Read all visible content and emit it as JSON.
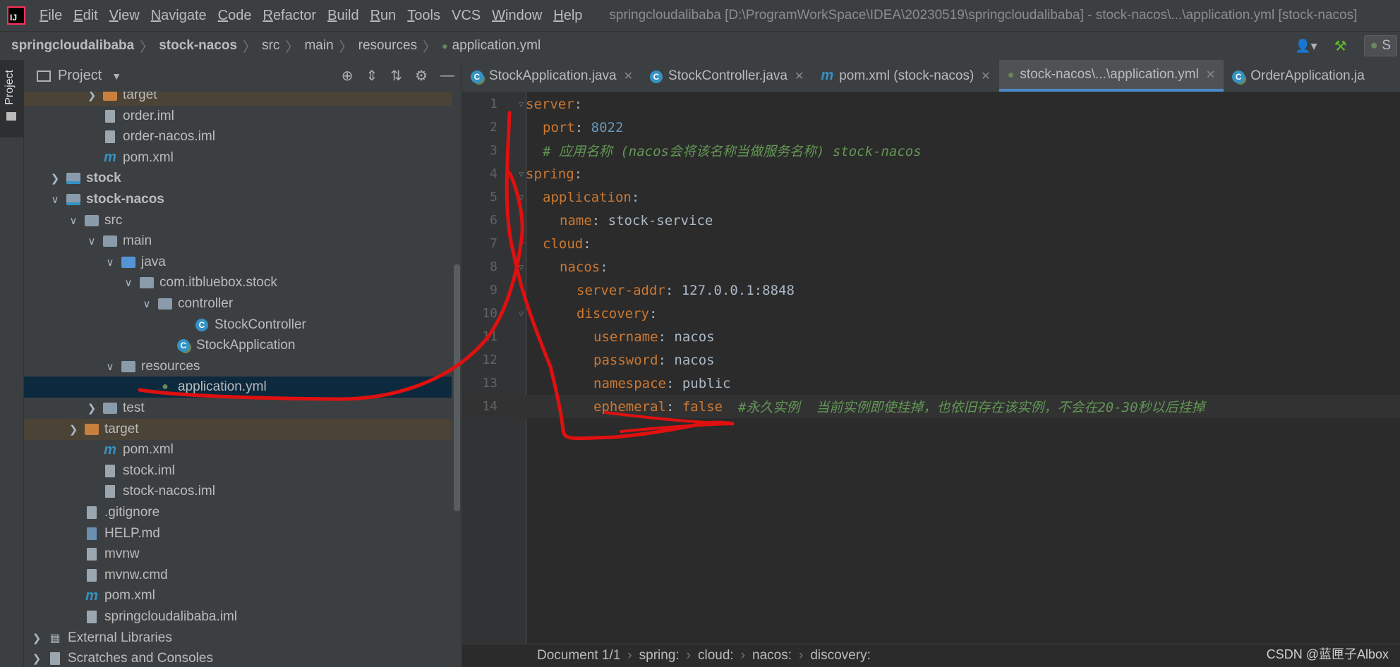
{
  "menubar": {
    "items": [
      {
        "u": "F",
        "rest": "ile"
      },
      {
        "u": "E",
        "rest": "dit"
      },
      {
        "u": "V",
        "rest": "iew"
      },
      {
        "u": "N",
        "rest": "avigate"
      },
      {
        "u": "C",
        "rest": "ode"
      },
      {
        "u": "R",
        "rest": "efactor"
      },
      {
        "u": "B",
        "rest": "uild"
      },
      {
        "u": "R",
        "rest": "un"
      },
      {
        "u": "T",
        "rest": "ools"
      },
      {
        "u": "",
        "rest": "VCS"
      },
      {
        "u": "W",
        "rest": "indow"
      },
      {
        "u": "H",
        "rest": "elp"
      }
    ],
    "title": "springcloudalibaba [D:\\ProgramWorkSpace\\IDEA\\20230519\\springcloudalibaba] - stock-nacos\\...\\application.yml [stock-nacos]"
  },
  "navbar": {
    "crumbs": [
      "springcloudalibaba",
      "stock-nacos",
      "src",
      "main",
      "resources",
      "application.yml"
    ],
    "run_label": "S"
  },
  "sidebar": {
    "project_tab": "Project"
  },
  "project": {
    "header": "Project",
    "rows": [
      {
        "label": "target",
        "indent": 3,
        "arrow": ">",
        "icon": "folder-orange",
        "excluded": true
      },
      {
        "label": "order.iml",
        "indent": 3,
        "arrow": "",
        "icon": "iml"
      },
      {
        "label": "order-nacos.iml",
        "indent": 3,
        "arrow": "",
        "icon": "iml"
      },
      {
        "label": "pom.xml",
        "indent": 3,
        "arrow": "",
        "icon": "maven"
      },
      {
        "label": "stock",
        "indent": 1,
        "arrow": ">",
        "icon": "module",
        "bold": true
      },
      {
        "label": "stock-nacos",
        "indent": 1,
        "arrow": "v",
        "icon": "module",
        "bold": true
      },
      {
        "label": "src",
        "indent": 2,
        "arrow": "v",
        "icon": "folder"
      },
      {
        "label": "main",
        "indent": 3,
        "arrow": "v",
        "icon": "folder"
      },
      {
        "label": "java",
        "indent": 4,
        "arrow": "v",
        "icon": "folder-blue"
      },
      {
        "label": "com.itbluebox.stock",
        "indent": 5,
        "arrow": "v",
        "icon": "package"
      },
      {
        "label": "controller",
        "indent": 6,
        "arrow": "v",
        "icon": "package"
      },
      {
        "label": "StockController",
        "indent": 8,
        "arrow": "",
        "icon": "class"
      },
      {
        "label": "StockApplication",
        "indent": 7,
        "arrow": "",
        "icon": "spring-class"
      },
      {
        "label": "resources",
        "indent": 4,
        "arrow": "v",
        "icon": "folder-res"
      },
      {
        "label": "application.yml",
        "indent": 6,
        "arrow": "",
        "icon": "yml",
        "selected": true
      },
      {
        "label": "test",
        "indent": 3,
        "arrow": ">",
        "icon": "folder"
      },
      {
        "label": "target",
        "indent": 2,
        "arrow": ">",
        "icon": "folder-orange",
        "excluded": true
      },
      {
        "label": "pom.xml",
        "indent": 3,
        "arrow": "",
        "icon": "maven"
      },
      {
        "label": "stock.iml",
        "indent": 3,
        "arrow": "",
        "icon": "iml"
      },
      {
        "label": "stock-nacos.iml",
        "indent": 3,
        "arrow": "",
        "icon": "iml"
      },
      {
        "label": ".gitignore",
        "indent": 2,
        "arrow": "",
        "icon": "file"
      },
      {
        "label": "HELP.md",
        "indent": 2,
        "arrow": "",
        "icon": "md"
      },
      {
        "label": "mvnw",
        "indent": 2,
        "arrow": "",
        "icon": "file"
      },
      {
        "label": "mvnw.cmd",
        "indent": 2,
        "arrow": "",
        "icon": "file"
      },
      {
        "label": "pom.xml",
        "indent": 2,
        "arrow": "",
        "icon": "maven"
      },
      {
        "label": "springcloudalibaba.iml",
        "indent": 2,
        "arrow": "",
        "icon": "iml"
      },
      {
        "label": "External Libraries",
        "indent": 0,
        "arrow": ">",
        "icon": "libs"
      },
      {
        "label": "Scratches and Consoles",
        "indent": 0,
        "arrow": ">",
        "icon": "scratch"
      }
    ]
  },
  "editor": {
    "tabs": [
      {
        "label": "StockApplication.java",
        "icon": "spring-class",
        "active": false
      },
      {
        "label": "StockController.java",
        "icon": "class",
        "active": false
      },
      {
        "label": "pom.xml (stock-nacos)",
        "icon": "maven",
        "active": false
      },
      {
        "label": "stock-nacos\\...\\application.yml",
        "icon": "yml",
        "active": true
      },
      {
        "label": "OrderApplication.ja",
        "icon": "spring-class",
        "active": false
      }
    ],
    "lines": [
      {
        "n": "1",
        "indent": 0,
        "key": "server",
        "sep": ":",
        "val": "",
        "type": ""
      },
      {
        "n": "2",
        "indent": 1,
        "key": "port",
        "sep": ": ",
        "val": "8022",
        "type": "num"
      },
      {
        "n": "3",
        "indent": 1,
        "key": "",
        "sep": "",
        "val": "# 应用名称 (nacos会将该名称当做服务名称) stock-nacos",
        "type": "cmt"
      },
      {
        "n": "4",
        "indent": 0,
        "key": "spring",
        "sep": ":",
        "val": "",
        "type": ""
      },
      {
        "n": "5",
        "indent": 1,
        "key": "application",
        "sep": ":",
        "val": "",
        "type": ""
      },
      {
        "n": "6",
        "indent": 2,
        "key": "name",
        "sep": ": ",
        "val": "stock-service",
        "type": "val"
      },
      {
        "n": "7",
        "indent": 1,
        "key": "cloud",
        "sep": ":",
        "val": "",
        "type": ""
      },
      {
        "n": "8",
        "indent": 2,
        "key": "nacos",
        "sep": ":",
        "val": "",
        "type": ""
      },
      {
        "n": "9",
        "indent": 3,
        "key": "server-addr",
        "sep": ": ",
        "val": "127.0.0.1:8848",
        "type": "val"
      },
      {
        "n": "10",
        "indent": 3,
        "key": "discovery",
        "sep": ":",
        "val": "",
        "type": ""
      },
      {
        "n": "11",
        "indent": 4,
        "key": "username",
        "sep": ": ",
        "val": "nacos",
        "type": "val"
      },
      {
        "n": "12",
        "indent": 4,
        "key": "password",
        "sep": ": ",
        "val": "nacos",
        "type": "val"
      },
      {
        "n": "13",
        "indent": 4,
        "key": "namespace",
        "sep": ": ",
        "val": "public",
        "type": "val"
      },
      {
        "n": "14",
        "indent": 4,
        "key": "ephemeral",
        "sep": ": ",
        "val": "false",
        "type": "kw",
        "comment": "#永久实例  当前实例即使挂掉，也依旧存在该实例，不会在20-30秒以后挂掉",
        "current": true
      }
    ],
    "breadcrumb": [
      "Document 1/1",
      "spring:",
      "cloud:",
      "nacos:",
      "discovery:"
    ]
  },
  "watermark": "CSDN @蓝匣子Albox",
  "colors": {
    "annotation": "#e01010",
    "accent": "#4a88c7"
  }
}
